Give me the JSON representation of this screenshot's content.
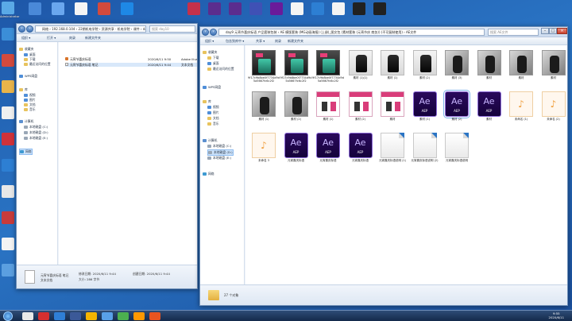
{
  "desktop": {
    "left_icons": [
      {
        "label": "Administrator",
        "color": "#5aa9e6"
      },
      {
        "label": "",
        "color": "#3b8ed8"
      },
      {
        "label": "",
        "color": "#d24a3d"
      },
      {
        "label": "",
        "color": "#e9b44a"
      },
      {
        "label": "",
        "color": "#f0f0f0"
      },
      {
        "label": "",
        "color": "#d0323a"
      },
      {
        "label": "",
        "color": "#2d7fd3"
      },
      {
        "label": "",
        "color": "#e8e8e8"
      },
      {
        "label": "",
        "color": "#c73b3b"
      },
      {
        "label": "",
        "color": "#f4f4f4"
      },
      {
        "label": "",
        "color": "#5b9fe0"
      }
    ],
    "top_icons": [
      {
        "label": "",
        "color": "#4a89d8"
      },
      {
        "label": "",
        "color": "#6aa7ee"
      },
      {
        "label": "",
        "color": "#f5f5f5"
      },
      {
        "label": "",
        "color": "#d24a3d"
      },
      {
        "label": "",
        "color": "#1e88e5"
      },
      {
        "label": "",
        "color": "#c4314b"
      },
      {
        "label": "",
        "color": "#5b2d8e"
      },
      {
        "label": "",
        "color": "#5b2d8e"
      },
      {
        "label": "",
        "color": "#3f51b5"
      },
      {
        "label": "",
        "color": "#6a1b9a"
      },
      {
        "label": "",
        "color": "#f4f4f4"
      },
      {
        "label": "",
        "color": "#2d7fd3"
      },
      {
        "label": "",
        "color": "#f4f4f4"
      },
      {
        "label": "",
        "color": "#212121"
      },
      {
        "label": "",
        "color": "#212121"
      }
    ]
  },
  "left_window": {
    "address": "网络 › 192.168.0.104 › 22期机电学院 › 资源共享 · 机电学院 › 课件 › day10",
    "search_placeholder": "搜索 day10",
    "toolbar": {
      "organize": "组织 ▾",
      "open": "打开 ▾",
      "burn": "刻录",
      "new_folder": "新建文件夹"
    },
    "nav": {
      "favorites": "收藏夹",
      "fav_items": [
        "桌面",
        "下载",
        "最近访问的位置"
      ],
      "wps": "WPS网盘",
      "libraries": "库",
      "lib_items": [
        "视频",
        "图片",
        "文档",
        "音乐"
      ],
      "computer": "计算机",
      "drives": [
        "本地磁盘 (C:)",
        "本地磁盘 (D:)",
        "本地磁盘 (E:)"
      ],
      "network": "网络"
    },
    "files": [
      {
        "name": "元宵节喜庆标语",
        "date": "2020/6/11 9:50",
        "type": "Adobe Illust",
        "size": ""
      },
      {
        "name": "元宵节喜庆标语 笔记",
        "date": "2020/6/11 9:44",
        "type": "文本文档",
        "size": ""
      }
    ],
    "details": {
      "name": "元宵节喜庆标语 笔记",
      "modified_label": "修改日期: 2020/6/11 9:44",
      "created_label": "创建日期: 2020/6/11 9:44",
      "type": "文本文档",
      "size": "大小: 286 字节"
    }
  },
  "right_window": {
    "address": "day9 元宵节喜庆标语 产品套装包装 › AE 模版套装 (MG动画海报) (上册)_图文包 (素材套装 (元宵节庆 商务)) (不可复制使用) › AE文件",
    "search_placeholder": "搜索 AE文件",
    "toolbar": {
      "organize": "组织 ▾",
      "include": "包含到库中 ▾",
      "share": "共享 ▾",
      "burn": "刻录",
      "new_folder": "新建文件夹"
    },
    "nav": {
      "favorites": "收藏夹",
      "fav_items": [
        "下载",
        "桌面",
        "最近访问的位置"
      ],
      "wps": "WPS网盘",
      "libraries": "库",
      "lib_items": [
        "视频",
        "图片",
        "文档",
        "音乐"
      ],
      "computer": "计算机",
      "drives": [
        "本地磁盘 (C:)",
        "本地磁盘 (D:)",
        "本地磁盘 (E:)"
      ],
      "network": "网络"
    },
    "thumbs": [
      {
        "kind": "psd",
        "caption": "9f17c9b8be0f7734d9d5a5667fc6c2f2"
      },
      {
        "kind": "psd",
        "caption": "9f17c9b8be0f7734d9d5a5667fc6c2f2"
      },
      {
        "kind": "psd",
        "caption": "9f17c9b8be0f7734d9d5a5667fc6c2f2"
      },
      {
        "kind": "bag",
        "caption": "素材 (1)(1)"
      },
      {
        "kind": "bag",
        "caption": "素材 (1)"
      },
      {
        "kind": "bag",
        "caption": "素材 (2)"
      },
      {
        "kind": "photo",
        "caption": "素材 (3)"
      },
      {
        "kind": "photo",
        "caption": "素材"
      },
      {
        "kind": "photo",
        "caption": "素材"
      },
      {
        "kind": "photo",
        "caption": "素材"
      },
      {
        "kind": "photo",
        "caption": "素材 (1)"
      },
      {
        "kind": "photo",
        "caption": "素材 (2)"
      },
      {
        "kind": "pink",
        "caption": "素材 (1)"
      },
      {
        "kind": "pink",
        "caption": "素材 (2)"
      },
      {
        "kind": "pink",
        "caption": "素材"
      },
      {
        "kind": "ae",
        "caption": "素材 (1)"
      },
      {
        "kind": "ae",
        "caption": "素材 (2)"
      },
      {
        "kind": "ae",
        "caption": "素材"
      },
      {
        "kind": "audio",
        "caption": "未命名 (1)"
      },
      {
        "kind": "audio",
        "caption": "未命名 (2)"
      },
      {
        "kind": "audio",
        "caption": "未命名 3"
      },
      {
        "kind": "ae",
        "caption": "元宵喜庆标语"
      },
      {
        "kind": "ae",
        "caption": "元宵喜庆标语"
      },
      {
        "kind": "ae",
        "caption": "元宵喜庆标语"
      },
      {
        "kind": "doc",
        "caption": "元宵喜庆标语说明 (1)"
      },
      {
        "kind": "doc",
        "caption": "元宵喜庆标语说明 (2)"
      },
      {
        "kind": "doc",
        "caption": "元宵喜庆标语说明"
      }
    ],
    "ae_text": "Ae",
    "ae_sub": "AEP",
    "status": "27 个对象"
  },
  "taskbar": {
    "icons": [
      "#e8e8e8",
      "#d62f2f",
      "#2f7fd6",
      "#3b5998",
      "#f4b400",
      "#58a0e8",
      "#4caf50",
      "#ff9800",
      "#e95420"
    ],
    "time": "9:55",
    "date": "2020/6/11"
  }
}
